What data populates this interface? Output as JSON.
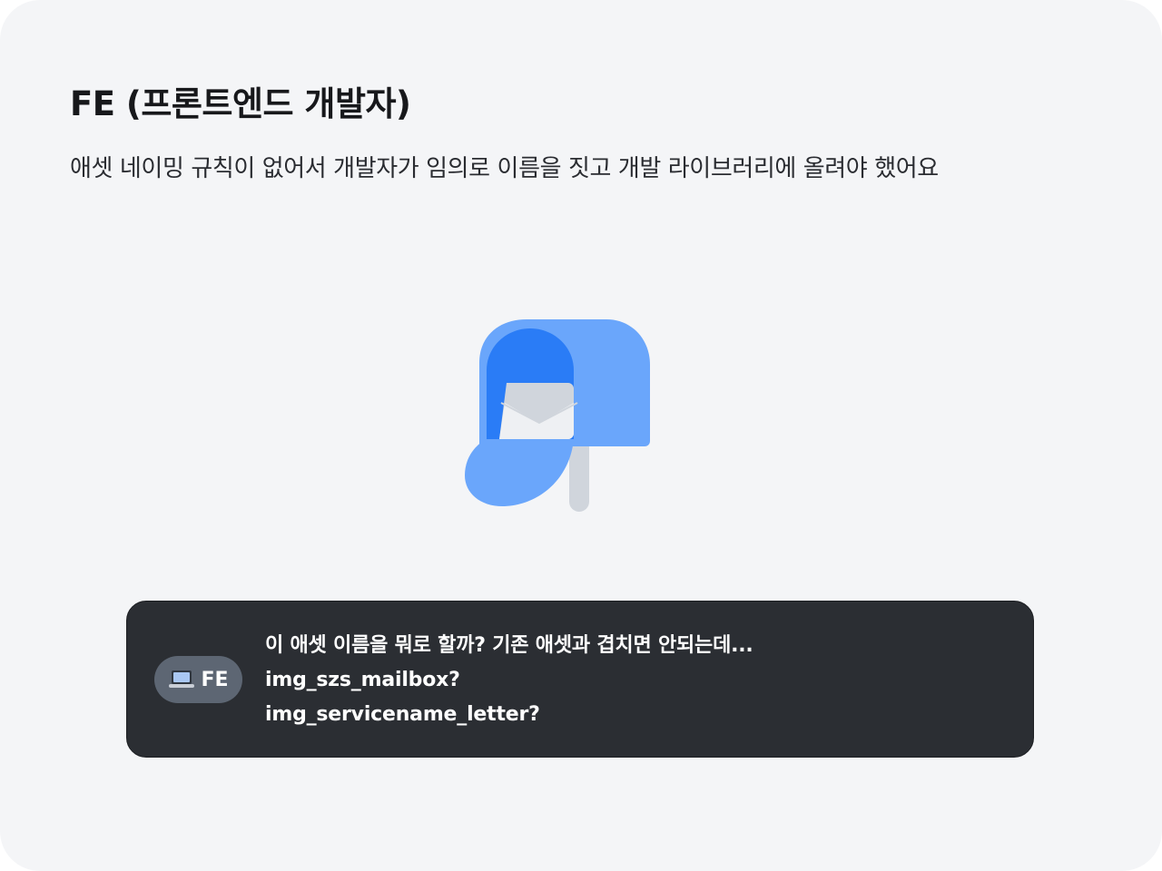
{
  "heading": {
    "title": "FE (프론트엔드 개발자)",
    "description": "애셋 네이밍 규칙이 없어서 개발자가 임의로 이름을 짓고 개발 라이브러리에 올려야 했어요"
  },
  "illustration": {
    "icon": "mailbox-icon",
    "colors": {
      "body_light": "#6aa6fb",
      "body_dark": "#2a7cf6",
      "envelope": "#d0d5dc",
      "post": "#d0d5dc"
    }
  },
  "message": {
    "badge": {
      "icon": "laptop-icon",
      "label": "FE"
    },
    "lines": [
      "이 애셋 이름을 뭐로 할까? 기존 애셋과 겹치면 안되는데...",
      "img_szs_mailbox?",
      "img_servicename_letter?"
    ],
    "colors": {
      "background": "#2b2e33",
      "badge": "#5d6673",
      "text": "#ffffff"
    }
  }
}
